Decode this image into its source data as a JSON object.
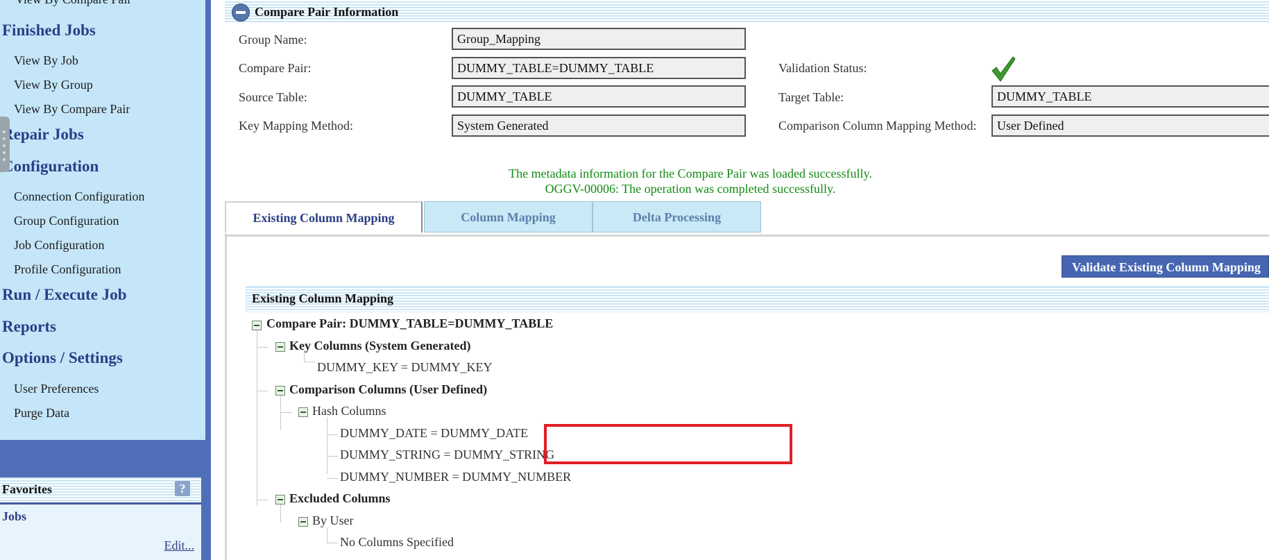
{
  "nav": {
    "cut_item": "View By Compare Pair",
    "finished_jobs": "Finished Jobs",
    "fj_items": [
      "View By Job",
      "View By Group",
      "View By Compare Pair"
    ],
    "repair_jobs": "Repair Jobs",
    "configuration": "Configuration",
    "config_items": [
      "Connection Configuration",
      "Group Configuration",
      "Job Configuration",
      "Profile Configuration"
    ],
    "run_execute": "Run / Execute Job",
    "reports": "Reports",
    "options_settings": "Options / Settings",
    "options_items": [
      "User Preferences",
      "Purge Data"
    ]
  },
  "favorites": {
    "title": "Favorites",
    "help_icon": "question-icon",
    "jobs": "Jobs",
    "edit": "Edit..."
  },
  "section": {
    "title": "Compare Pair Information",
    "collapse_icon": "collapse-icon"
  },
  "form": {
    "group_name_label": "Group Name:",
    "group_name_value": "Group_Mapping",
    "compare_pair_label": "Compare Pair:",
    "compare_pair_value": "DUMMY_TABLE=DUMMY_TABLE",
    "source_table_label": "Source Table:",
    "source_table_value": "DUMMY_TABLE",
    "key_mapping_label": "Key Mapping Method:",
    "key_mapping_value": "System Generated",
    "validation_status_label": "Validation Status:",
    "validation_status_icon": "check-icon",
    "target_table_label": "Target Table:",
    "target_table_value": "DUMMY_TABLE",
    "comparison_mapping_label": "Comparison Column Mapping Method:",
    "comparison_mapping_value": "User Defined"
  },
  "messages": {
    "line1": "The metadata information for the Compare Pair was loaded successfully.",
    "line2": "OGGV-00006: The operation was completed successfully.",
    "color": "#138a13"
  },
  "tabs": [
    "Existing Column Mapping",
    "Column Mapping",
    "Delta Processing"
  ],
  "validate_button": "Validate Existing Column Mapping",
  "existing_mapping": {
    "title": "Existing Column Mapping",
    "compare_pair": "Compare Pair: DUMMY_TABLE=DUMMY_TABLE",
    "key_columns": "Key Columns (System Generated)",
    "key_items": [
      "DUMMY_KEY = DUMMY_KEY"
    ],
    "comparison_columns": "Comparison Columns (User Defined)",
    "hash_columns": "Hash Columns",
    "hash_items": [
      "DUMMY_DATE = DUMMY_DATE",
      "DUMMY_STRING = DUMMY_STRING",
      "DUMMY_NUMBER = DUMMY_NUMBER"
    ],
    "excluded_columns": "Excluded Columns",
    "by_user": "By User",
    "by_user_items": [
      "No Columns Specified"
    ]
  },
  "colors": {
    "nav_bg": "#c5e6f9",
    "nav_heading": "#2a3e86",
    "accent_blue": "#4766b1",
    "highlight_red": "#e01f26"
  }
}
